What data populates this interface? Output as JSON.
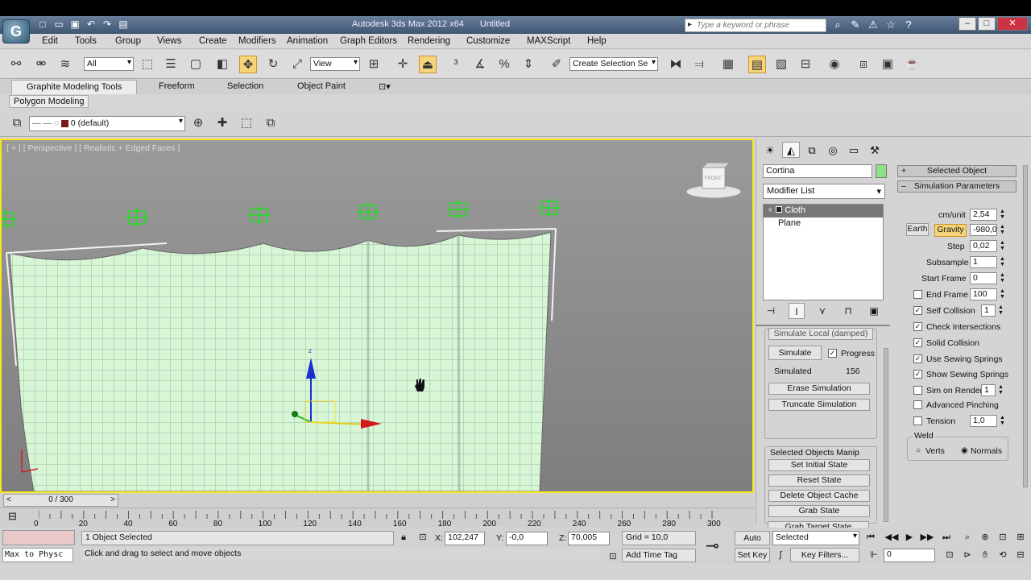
{
  "window": {
    "title": "Autodesk 3ds Max  2012 x64",
    "document": "Untitled",
    "search_placeholder": "Type a keyword or phrase"
  },
  "menu": [
    "Edit",
    "Tools",
    "Group",
    "Views",
    "Create",
    "Modifiers",
    "Animation",
    "Graph Editors",
    "Rendering",
    "Customize",
    "MAXScript",
    "Help"
  ],
  "toolbar": {
    "selection_filter": "All",
    "ref_coord": "View",
    "named_selection": "Create Selection Se"
  },
  "ribbon": {
    "tabs": [
      "Graphite Modeling Tools",
      "Freeform",
      "Selection",
      "Object Paint"
    ],
    "subtab": "Polygon Modeling"
  },
  "layer": {
    "current": "0 (default)"
  },
  "viewport": {
    "label": "[ + ] [ Perspective ] [ Realistic + Edged Faces ]",
    "viewcube_face": "FRONT",
    "gizmo_axis": "z"
  },
  "command_panel": {
    "object_name": "Cortina",
    "modifier_list": "Modifier List",
    "stack": [
      "Cloth",
      "Plane"
    ],
    "cut_label": "Simulate Local (damped)",
    "simulate_button": "Simulate",
    "progress_label": "Progress",
    "simulated_label": "Simulated",
    "simulated_value": "156",
    "buttons": [
      "Erase Simulation",
      "Truncate Simulation"
    ],
    "selected_objects_group": "Selected Objects Manip",
    "state_buttons": [
      "Set Initial State",
      "Reset State",
      "Delete Object Cache",
      "Grab State",
      "Grab Target State"
    ]
  },
  "cloth_params": {
    "selected_object_header": "Selected Object",
    "sim_params_header": "Simulation Parameters",
    "cm_unit_label": "cm/unit",
    "cm_unit": "2,54",
    "earth_label": "Earth",
    "gravity_label": "Gravity",
    "gravity": "-980,0",
    "step_label": "Step",
    "step": "0,02",
    "subsample_label": "Subsample",
    "subsample": "1",
    "start_frame_label": "Start Frame",
    "start_frame": "0",
    "end_frame_label": "End Frame",
    "end_frame": "100",
    "self_collision_label": "Self Collision",
    "self_collision": "1",
    "check_intersections": "Check Intersections",
    "solid_collision": "Solid Collision",
    "use_sewing": "Use Sewing Springs",
    "show_sewing": "Show Sewing Springs",
    "sim_on_render_label": "Sim on Render",
    "sim_on_render": "1",
    "advanced_pinching": "Advanced Pinching",
    "tension_label": "Tension",
    "tension": "1,0",
    "weld_label": "Weld",
    "weld_verts": "Verts",
    "weld_normals": "Normals"
  },
  "timeline": {
    "slider": "0 / 300",
    "ticks": [
      "0",
      "20",
      "40",
      "60",
      "80",
      "100",
      "120",
      "140",
      "160",
      "180",
      "200",
      "220",
      "240",
      "260",
      "280",
      "300"
    ]
  },
  "status": {
    "maxscript": "Max to Physc",
    "selected": "1 Object Selected",
    "prompt": "Click and drag to select and move objects",
    "x": "102,247",
    "y": "-0,0",
    "z": "70,005",
    "grid": "Grid = 10,0",
    "add_time_tag": "Add Time Tag",
    "auto_key": "Auto Key",
    "set_key": "Set Key",
    "key_mode": "Selected",
    "key_filters": "Key Filters...",
    "frame": "0"
  },
  "colors": {
    "viewport_bg": "#8a8a8a",
    "cloth": "#d7f6d6",
    "active_border": "#f7e71c",
    "gizmo_green": "#22dd22"
  }
}
